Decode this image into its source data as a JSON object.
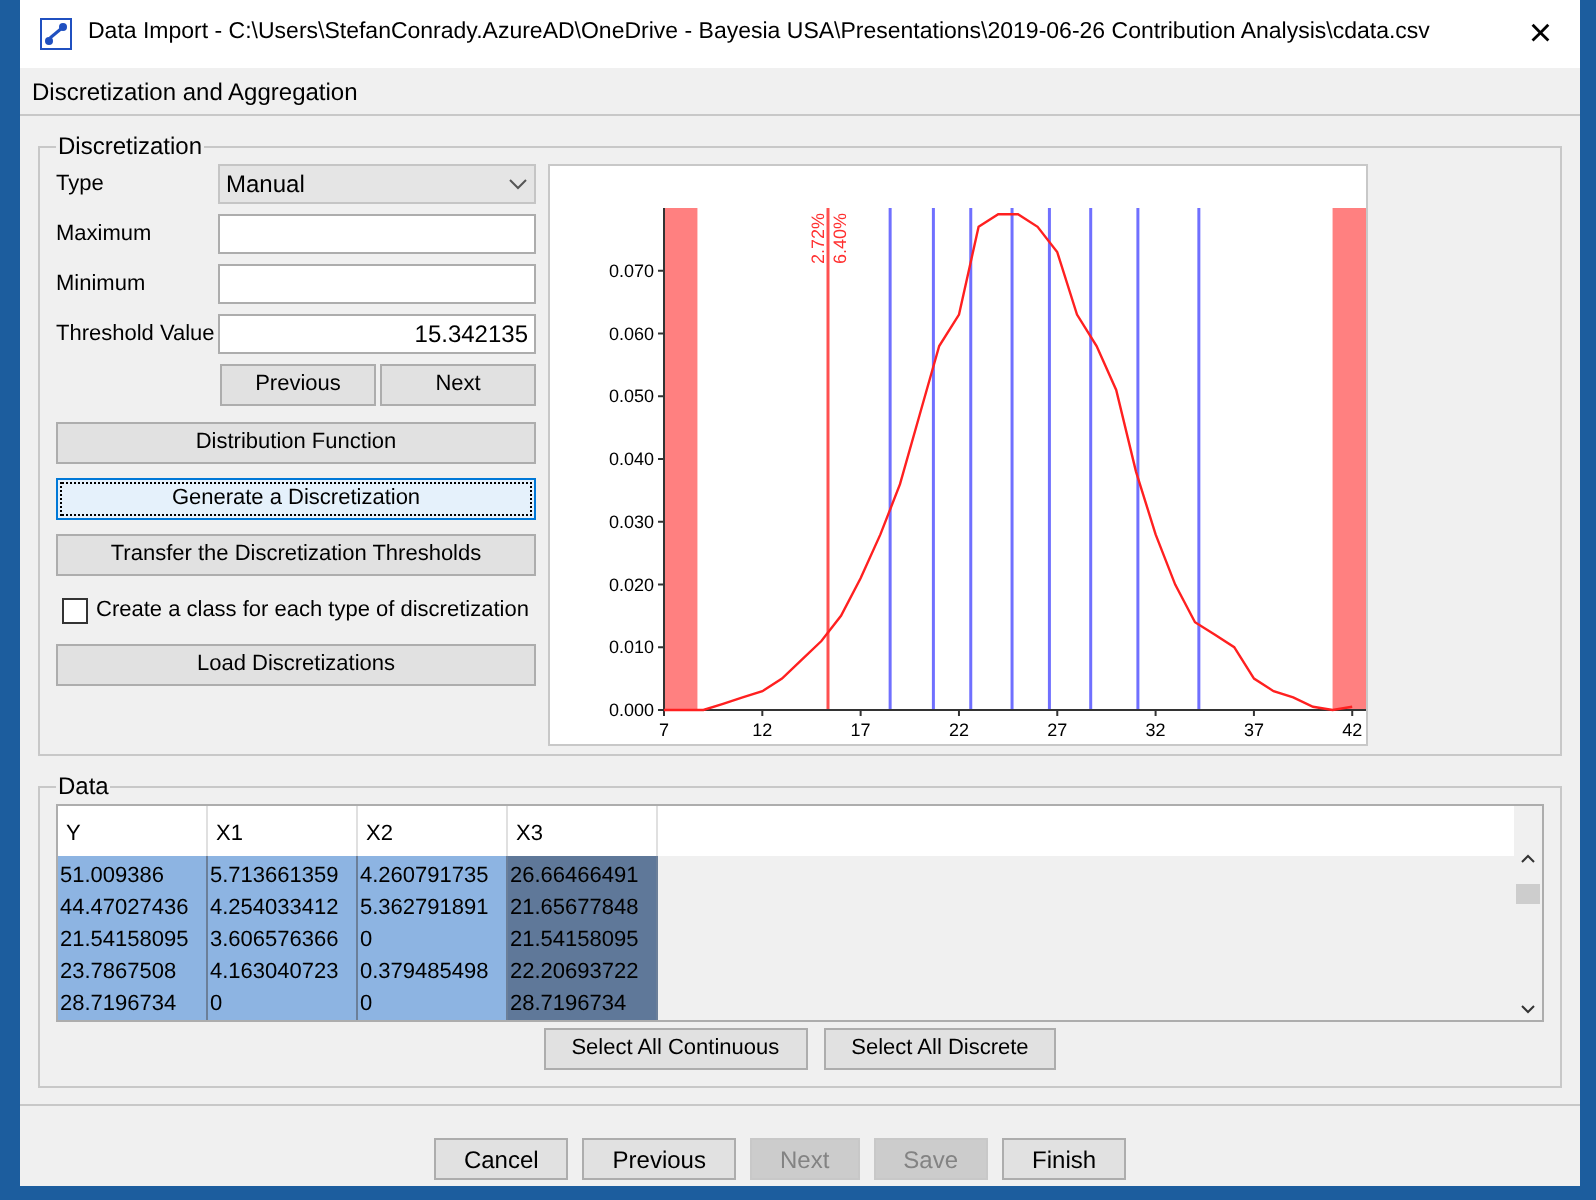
{
  "window": {
    "title": "Data Import - C:\\Users\\StefanConrady.AzureAD\\OneDrive - Bayesia USA\\Presentations\\2019-06-26 Contribution Analysis\\cdata.csv",
    "close": "×"
  },
  "step_title": "Discretization and Aggregation",
  "discretization": {
    "legend": "Discretization",
    "fields": [
      {
        "kind": "select",
        "label": "Type",
        "value": "Manual"
      },
      {
        "kind": "input",
        "label": "Maximum"
      },
      {
        "kind": "input",
        "label": "Minimum"
      },
      {
        "kind": "input",
        "label": "Threshold Value",
        "value": "15.342135"
      }
    ],
    "nav_buttons": [
      "Previous",
      "Next"
    ],
    "buttons": [
      {
        "label": "Distribution Function",
        "focused": false
      },
      {
        "label": "Generate a Discretization",
        "focused": true
      },
      {
        "label": "Transfer the Discretization Thresholds",
        "focused": false
      }
    ],
    "checkbox": {
      "label": "Create a class for each type of discretization",
      "checked": false
    },
    "load_button": "Load Discretizations",
    "chart": {
      "chart_data": {
        "type": "line",
        "x": [
          7,
          8,
          9,
          10,
          11,
          12,
          13,
          14,
          15,
          16,
          17,
          18,
          19,
          20,
          21,
          22,
          23,
          24,
          25,
          26,
          27,
          28,
          29,
          30,
          31,
          32,
          33,
          34,
          35,
          36,
          37,
          38,
          39,
          40,
          41,
          42
        ],
        "series": [
          {
            "color": "#ff2020",
            "values": [
              0,
              0,
              0,
              0.001,
              0.002,
              0.003,
              0.005,
              0.008,
              0.011,
              0.015,
              0.021,
              0.028,
              0.036,
              0.047,
              0.058,
              0.063,
              0.077,
              0.079,
              0.079,
              0.077,
              0.073,
              0.063,
              0.058,
              0.051,
              0.038,
              0.028,
              0.02,
              0.014,
              0.012,
              0.01,
              0.005,
              0.003,
              0.002,
              0.0005,
              0,
              0.0005
            ]
          }
        ],
        "xlim": [
          7,
          42.7
        ],
        "ylim": [
          0,
          0.08
        ],
        "xticks": [
          7,
          12,
          17,
          22,
          27,
          32,
          37,
          42
        ],
        "yticks": [
          {
            "value": 0,
            "label": "0.000"
          },
          {
            "value": 0.01,
            "label": "0.010"
          },
          {
            "value": 0.02,
            "label": "0.020"
          },
          {
            "value": 0.03,
            "label": "0.030"
          },
          {
            "value": 0.04,
            "label": "0.040"
          },
          {
            "value": 0.05,
            "label": "0.050"
          },
          {
            "value": 0.06,
            "label": "0.060"
          },
          {
            "value": 0.07,
            "label": "0.070"
          }
        ],
        "bands": [
          {
            "axis": "x",
            "from": 7,
            "to": 8.7,
            "color": "#ff8080"
          },
          {
            "axis": "x",
            "from": 41,
            "to": 42.7,
            "color": "#ff8080"
          }
        ],
        "ref_lines": [
          {
            "axis": "x",
            "value": 15.34,
            "color": "#ff5050"
          },
          {
            "axis": "x",
            "value": 18.5,
            "color": "#7070ff"
          },
          {
            "axis": "x",
            "value": 20.7,
            "color": "#7070ff"
          },
          {
            "axis": "x",
            "value": 22.6,
            "color": "#7070ff"
          },
          {
            "axis": "x",
            "value": 24.7,
            "color": "#7070ff"
          },
          {
            "axis": "x",
            "value": 26.6,
            "color": "#7070ff"
          },
          {
            "axis": "x",
            "value": 28.7,
            "color": "#7070ff"
          },
          {
            "axis": "x",
            "value": 31.1,
            "color": "#7070ff"
          },
          {
            "axis": "x",
            "value": 34.2,
            "color": "#7070ff"
          }
        ],
        "annotations": [
          "2.72%",
          "6.40%"
        ]
      }
    }
  },
  "data": {
    "legend": "Data",
    "table": {
      "columns": [
        {
          "label": "Y",
          "selected": false
        },
        {
          "label": "X1",
          "selected": false
        },
        {
          "label": "X2",
          "selected": false
        },
        {
          "label": "X3",
          "selected": true
        }
      ],
      "rows": [
        [
          "51.009386",
          "5.713661359",
          "4.260791735",
          "26.66466491"
        ],
        [
          "44.47027436",
          "4.254033412",
          "5.362791891",
          "21.65677848"
        ],
        [
          "21.54158095",
          "3.606576366",
          "0",
          "21.54158095"
        ],
        [
          "23.7867508",
          "4.163040723",
          "0.379485498",
          "22.20693722"
        ],
        [
          "28.7196734",
          "0",
          "0",
          "28.7196734"
        ]
      ]
    },
    "buttons": [
      "Select All Continuous",
      "Select All Discrete"
    ]
  },
  "footer": [
    {
      "label": "Cancel",
      "disabled": false
    },
    {
      "label": "Previous",
      "disabled": false
    },
    {
      "label": "Next",
      "disabled": true
    },
    {
      "label": "Save",
      "disabled": true
    },
    {
      "label": "Finish",
      "disabled": false
    }
  ]
}
